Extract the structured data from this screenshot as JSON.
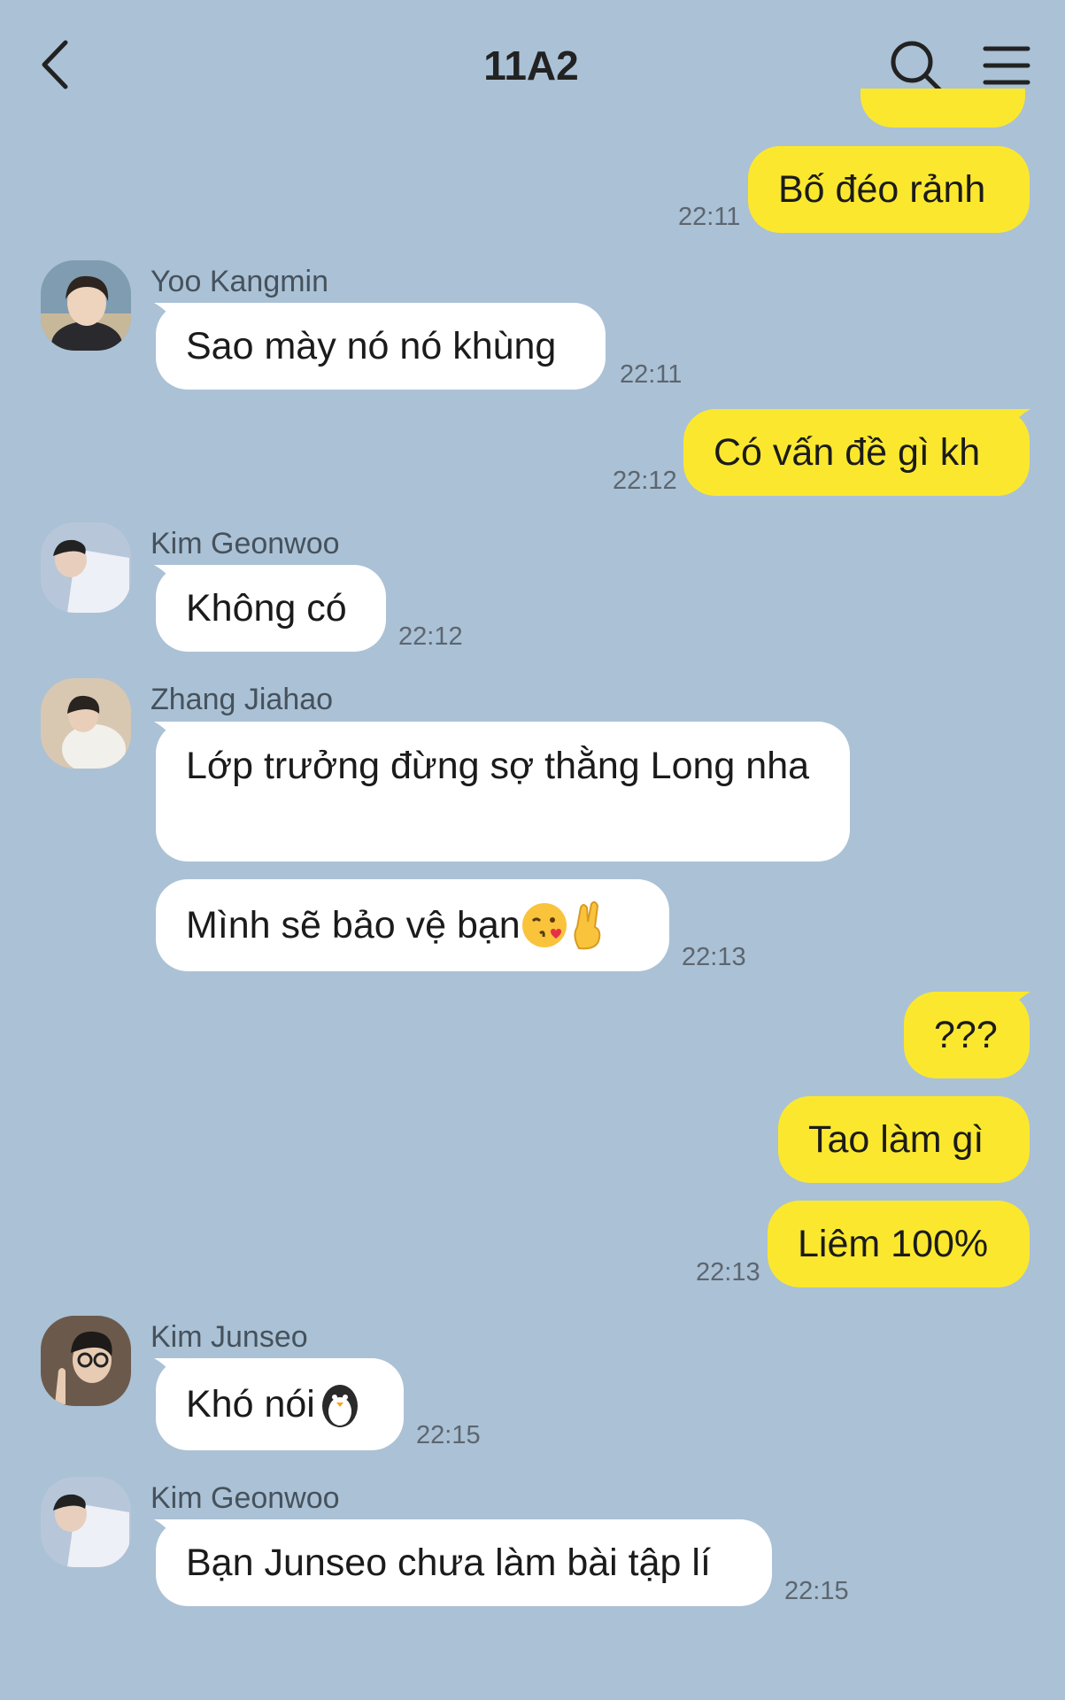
{
  "header": {
    "title": "11A2"
  },
  "colors": {
    "background": "#abc1d5",
    "my_bubble": "#fbe82e",
    "their_bubble": "#ffffff"
  },
  "messages": [
    {
      "side": "right",
      "text": "Bố đéo rảnh",
      "time": "22:11"
    },
    {
      "side": "left",
      "sender": "Yoo Kangmin",
      "text": "Sao mày nó nó khùng",
      "time": "22:11"
    },
    {
      "side": "right",
      "text": "Có vấn đề gì kh",
      "time": "22:12"
    },
    {
      "side": "left",
      "sender": "Kim Geonwoo",
      "text": "Không có",
      "time": "22:12"
    },
    {
      "side": "left",
      "sender": "Zhang Jiahao",
      "text": "Lớp trưởng đừng sợ thằng Long nha"
    },
    {
      "side": "left",
      "text": "Mình sẽ bảo vệ bạn",
      "emojis": [
        "kissing-heart-emoji",
        "crossed-fingers-emoji"
      ],
      "time": "22:13"
    },
    {
      "side": "right",
      "text": "???"
    },
    {
      "side": "right",
      "text": "Tao làm gì"
    },
    {
      "side": "right",
      "text": "Liêm 100%",
      "time": "22:13"
    },
    {
      "side": "left",
      "sender": "Kim Junseo",
      "text": "Khó nói",
      "emojis": [
        "penguin-emoji"
      ],
      "time": "22:15"
    },
    {
      "side": "left",
      "sender": "Kim Geonwoo",
      "text": "Bạn Junseo chưa làm bài tập lí",
      "time": "22:15"
    }
  ]
}
